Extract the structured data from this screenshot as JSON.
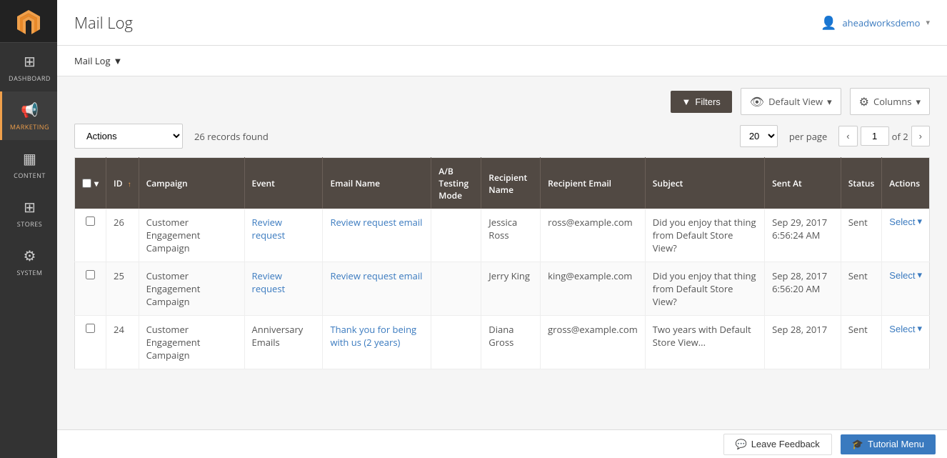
{
  "sidebar": {
    "items": [
      {
        "id": "dashboard",
        "label": "DASHBOARD",
        "icon": "⊞",
        "active": false
      },
      {
        "id": "marketing",
        "label": "MARKETING",
        "icon": "📢",
        "active": true
      },
      {
        "id": "content",
        "label": "CONTENT",
        "icon": "▦",
        "active": false
      },
      {
        "id": "stores",
        "label": "STORES",
        "icon": "🏪",
        "active": false
      },
      {
        "id": "system",
        "label": "SYSTEM",
        "icon": "⚙",
        "active": false
      }
    ]
  },
  "header": {
    "title": "Mail Log",
    "user": "aheadworksdemo",
    "user_icon": "👤"
  },
  "breadcrumb": {
    "label": "Mail Log",
    "arrow": "▼"
  },
  "toolbar": {
    "filters_label": "Filters",
    "default_view_label": "Default View",
    "columns_label": "Columns"
  },
  "actions_bar": {
    "actions_label": "Actions",
    "records_found": "26 records found",
    "per_page_value": "20",
    "per_page_label": "per page",
    "current_page": "1",
    "total_pages": "of 2"
  },
  "table": {
    "columns": [
      {
        "id": "checkbox",
        "label": ""
      },
      {
        "id": "id",
        "label": "ID",
        "sortable": true
      },
      {
        "id": "campaign",
        "label": "Campaign"
      },
      {
        "id": "event",
        "label": "Event"
      },
      {
        "id": "email_name",
        "label": "Email Name"
      },
      {
        "id": "ab_testing",
        "label": "A/B Testing Mode"
      },
      {
        "id": "recipient_name",
        "label": "Recipient Name"
      },
      {
        "id": "recipient_email",
        "label": "Recipient Email"
      },
      {
        "id": "subject",
        "label": "Subject"
      },
      {
        "id": "sent_at",
        "label": "Sent At"
      },
      {
        "id": "status",
        "label": "Status"
      },
      {
        "id": "actions",
        "label": "Actions"
      }
    ],
    "rows": [
      {
        "id": "26",
        "campaign": "Customer Engagement Campaign",
        "event": "Review request",
        "email_name": "Review request email",
        "ab_testing": "",
        "recipient_name": "Jessica Ross",
        "recipient_email": "ross@example.com",
        "subject": "Did you enjoy that thing from Default Store View?",
        "sent_at": "Sep 29, 2017 6:56:24 AM",
        "status": "Sent",
        "actions_label": "Select"
      },
      {
        "id": "25",
        "campaign": "Customer Engagement Campaign",
        "event": "Review request",
        "email_name": "Review request email",
        "ab_testing": "",
        "recipient_name": "Jerry King",
        "recipient_email": "king@example.com",
        "subject": "Did you enjoy that thing from Default Store View?",
        "sent_at": "Sep 28, 2017 6:56:20 AM",
        "status": "Sent",
        "actions_label": "Select"
      },
      {
        "id": "24",
        "campaign": "Customer Engagement Campaign",
        "event": "Anniversary Emails",
        "email_name": "Thank you for being with us (2 years)",
        "ab_testing": "",
        "recipient_name": "Diana Gross",
        "recipient_email": "gross@example.com",
        "subject": "Two years with Default Store View...",
        "sent_at": "Sep 28, 2017",
        "status": "Sent",
        "actions_label": "Select"
      }
    ]
  },
  "bottom_bar": {
    "feedback_label": "Leave Feedback",
    "tutorial_label": "Tutorial Menu"
  }
}
